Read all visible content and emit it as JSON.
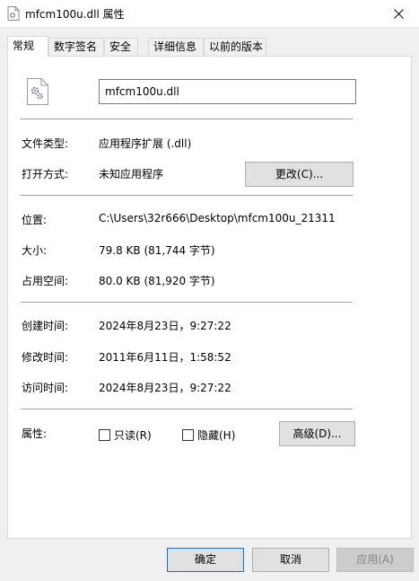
{
  "window": {
    "title": "mfcm100u.dll 属性",
    "close_icon": "close-icon"
  },
  "tabs": [
    {
      "label": "常规",
      "active": true
    },
    {
      "label": "数字签名",
      "active": false
    },
    {
      "label": "安全",
      "active": false
    },
    {
      "label": "详细信息",
      "active": false
    },
    {
      "label": "以前的版本",
      "active": false
    }
  ],
  "general": {
    "file_name": "mfcm100u.dll",
    "file_type_label": "文件类型:",
    "file_type_value": "应用程序扩展 (.dll)",
    "open_with_label": "打开方式:",
    "open_with_value": "未知应用程序",
    "change_button": "更改(C)...",
    "location_label": "位置:",
    "location_value": "C:\\Users\\32r666\\Desktop\\mfcm100u_21311",
    "size_label": "大小:",
    "size_value": "79.8 KB (81,744 字节)",
    "size_on_disk_label": "占用空间:",
    "size_on_disk_value": "80.0 KB (81,920 字节)",
    "created_label": "创建时间:",
    "created_value": "2024年8月23日，9:27:22",
    "modified_label": "修改时间:",
    "modified_value": "2011年6月11日，1:58:52",
    "accessed_label": "访问时间:",
    "accessed_value": "2024年8月23日，9:27:22",
    "attributes_label": "属性:",
    "readonly_label": "只读(R)",
    "hidden_label": "隐藏(H)",
    "advanced_button": "高级(D)..."
  },
  "footer": {
    "ok_button": "确定",
    "cancel_button": "取消",
    "apply_button": "应用(A)"
  },
  "colors": {
    "focus_border": "#0078d7",
    "panel_bg": "#ffffff",
    "window_bg": "#f0f0f0"
  }
}
